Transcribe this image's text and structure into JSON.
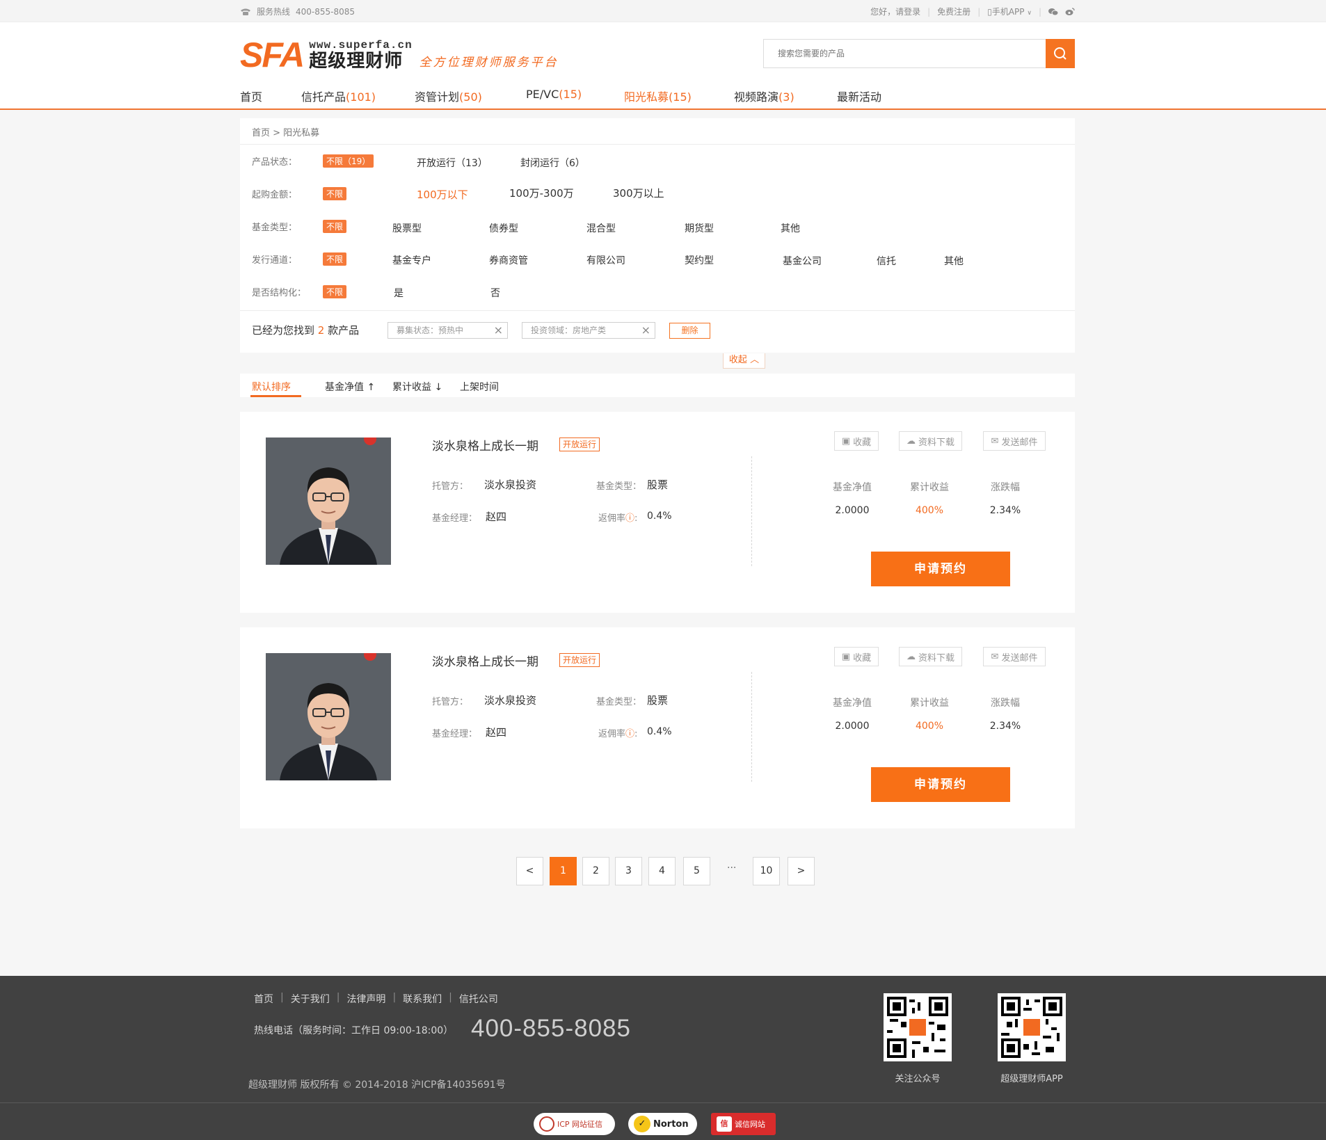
{
  "topbar": {
    "hotline_label": "服务热线",
    "hotline_number": "400-855-8085",
    "greeting": "您好，请登录",
    "register": "免费注册",
    "app": "手机APP"
  },
  "header": {
    "logo_mark": "SFA",
    "logo_url": "www.superfa.cn",
    "logo_name": "超级理财师",
    "slogan": "全方位理财师服务平台",
    "search_placeholder": "搜索您需要的产品"
  },
  "nav": [
    {
      "label": "首页",
      "count": ""
    },
    {
      "label": "信托产品",
      "count": "(101)"
    },
    {
      "label": "资管计划",
      "count": "(50)"
    },
    {
      "label": "PE/VC",
      "count": "(15)"
    },
    {
      "label": "阳光私募",
      "count": "(15)"
    },
    {
      "label": "视频路演",
      "count": "(3)"
    },
    {
      "label": "最新活动",
      "count": ""
    }
  ],
  "breadcrumb": "首页 > 阳光私募",
  "filters": {
    "status": {
      "label": "产品状态：",
      "selected": "不限（19）",
      "options": [
        "开放运行（13）",
        "封闭运行（6）"
      ]
    },
    "amount": {
      "label": "起购金额：",
      "selected": "不限",
      "options": [
        "100万以下",
        "100万-300万",
        "300万以上"
      ]
    },
    "fund_type": {
      "label": "基金类型：",
      "selected": "不限",
      "options": [
        "股票型",
        "债券型",
        "混合型",
        "期货型",
        "其他"
      ]
    },
    "channel": {
      "label": "发行通道：",
      "selected": "不限",
      "options": [
        "基金专户",
        "券商资管",
        "有限公司",
        "契约型",
        "基金公司",
        "信托",
        "其他"
      ]
    },
    "structured": {
      "label": "是否结构化：",
      "selected": "不限",
      "options": [
        "是",
        "否"
      ]
    }
  },
  "found": {
    "prefix": "已经为您找到",
    "count": "2",
    "suffix": "款产品"
  },
  "chips": [
    "募集状态：预热中",
    "投资领域：房地产类"
  ],
  "delete_label": "删除",
  "collapse_label": "收起",
  "sort": [
    "默认排序",
    "基金净值",
    "累计收益",
    "上架时间"
  ],
  "products": [
    {
      "title": "淡水泉格上成长一期",
      "status": "开放运行",
      "custodian_k": "托管方：",
      "custodian_v": "淡水泉投资",
      "type_k": "基金类型：",
      "type_v": "股票",
      "manager_k": "基金经理：",
      "manager_v": "赵四",
      "rebate_k": "返佣率",
      "rebate_v": "0.4%",
      "actions": [
        "收藏",
        "资料下载",
        "发送邮件"
      ],
      "stats": [
        {
          "k": "基金净值",
          "v": "2.0000"
        },
        {
          "k": "累计收益",
          "v": "400%"
        },
        {
          "k": "涨跌幅",
          "v": "2.34%"
        }
      ],
      "apply": "申请预约"
    },
    {
      "title": "淡水泉格上成长一期",
      "status": "开放运行",
      "custodian_k": "托管方：",
      "custodian_v": "淡水泉投资",
      "type_k": "基金类型：",
      "type_v": "股票",
      "manager_k": "基金经理：",
      "manager_v": "赵四",
      "rebate_k": "返佣率",
      "rebate_v": "0.4%",
      "actions": [
        "收藏",
        "资料下载",
        "发送邮件"
      ],
      "stats": [
        {
          "k": "基金净值",
          "v": "2.0000"
        },
        {
          "k": "累计收益",
          "v": "400%"
        },
        {
          "k": "涨跌幅",
          "v": "2.34%"
        }
      ],
      "apply": "申请预约"
    }
  ],
  "pagination": {
    "prev": "<",
    "pages": [
      "1",
      "2",
      "3",
      "4",
      "5"
    ],
    "ellipsis": "···",
    "last": "10",
    "next": ">",
    "current": "1"
  },
  "footer": {
    "links": [
      "首页",
      "关于我们",
      "法律声明",
      "联系我们",
      "信托公司"
    ],
    "hotline_label": "热线电话（服务时间：工作日 09:00-18:00）",
    "hotline": "400-855-8085",
    "copyright": "超级理财师  版权所有 © 2014-2018   沪ICP备14035691号",
    "qr_labels": [
      "关注公众号",
      "超级理财师APP"
    ],
    "badges": [
      "ICP 网站征信",
      "Norton",
      "诚信网站"
    ]
  },
  "colors": {
    "accent": "#f26a21",
    "button": "#f87016",
    "footer": "#414141"
  }
}
